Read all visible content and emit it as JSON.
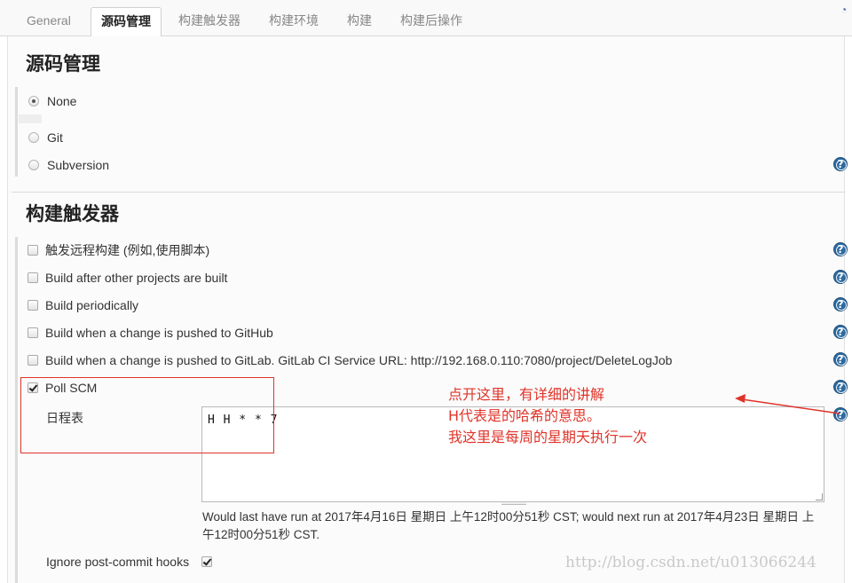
{
  "tabs": [
    {
      "label": "General",
      "active": false
    },
    {
      "label": "源码管理",
      "active": true
    },
    {
      "label": "构建触发器",
      "active": false
    },
    {
      "label": "构建环境",
      "active": false
    },
    {
      "label": "构建",
      "active": false
    },
    {
      "label": "构建后操作",
      "active": false
    }
  ],
  "scm": {
    "title": "源码管理",
    "options": [
      {
        "label": "None",
        "selected": true
      },
      {
        "label": "Git",
        "selected": false
      },
      {
        "label": "Subversion",
        "selected": false
      }
    ]
  },
  "triggers": {
    "title": "构建触发器",
    "items": [
      {
        "label": "触发远程构建 (例如,使用脚本)",
        "checked": false
      },
      {
        "label": "Build after other projects are built",
        "checked": false
      },
      {
        "label": "Build periodically",
        "checked": false
      },
      {
        "label": "Build when a change is pushed to GitHub",
        "checked": false
      },
      {
        "label": "Build when a change is pushed to GitLab. GitLab CI Service URL: http://192.168.0.110:7080/project/DeleteLogJob",
        "checked": false
      },
      {
        "label": "Poll SCM",
        "checked": true
      }
    ],
    "schedule_label": "日程表",
    "schedule_value": "H H * * 7",
    "schedule_info": "Would last have run at 2017年4月16日 星期日 上午12时00分51秒 CST; would next run at 2017年4月23日 星期日 上午12时00分51秒 CST.",
    "ignore_hooks_label": "Ignore post-commit hooks",
    "ignore_hooks_checked": true
  },
  "annotation": {
    "line1": "点开这里，有详细的讲解",
    "line2": "H代表是的哈希的意思。",
    "line3": "我这里是每周的星期天执行一次",
    "color": "#e0342a"
  },
  "help_glyph": "?",
  "watermark": "http://blog.csdn.net/u013066244"
}
